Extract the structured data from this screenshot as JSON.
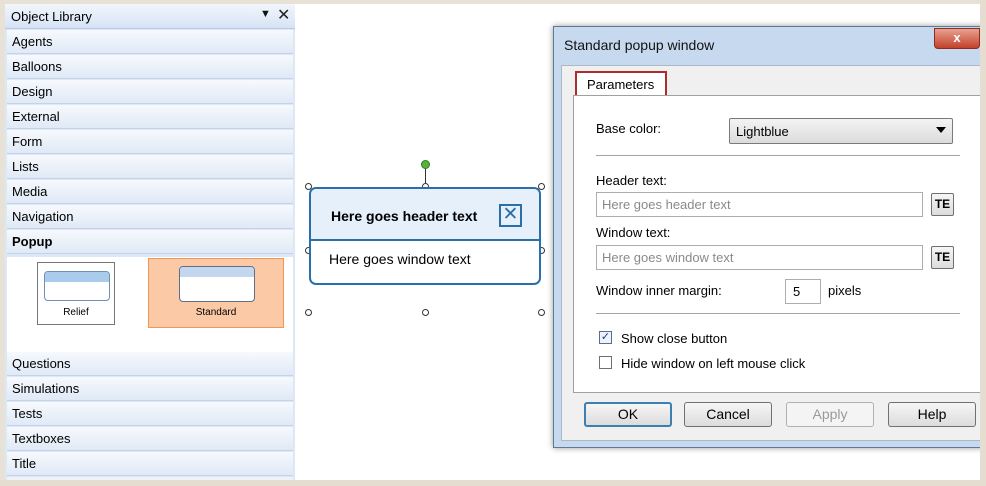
{
  "library": {
    "title": "Object Library",
    "pin_icon": "dropdown-arrow-icon",
    "close_icon": "close-icon",
    "categories_top": [
      "Agents",
      "Balloons",
      "Design",
      "External",
      "Form",
      "Lists",
      "Media",
      "Navigation",
      "Popup"
    ],
    "active_category": "Popup",
    "popup_items": [
      {
        "label": "Relief",
        "selected": false
      },
      {
        "label": "Standard",
        "selected": true
      }
    ],
    "categories_bottom": [
      "Questions",
      "Simulations",
      "Tests",
      "Textboxes",
      "Title"
    ]
  },
  "preview": {
    "header_text": "Here goes header text",
    "window_text": "Here goes window text",
    "close_glyph": "✕"
  },
  "dialog": {
    "title": "Standard popup window",
    "close_glyph": "x",
    "tab_label": "Parameters",
    "base_color_label": "Base color:",
    "base_color_value": "Lightblue",
    "header_text_label": "Header text:",
    "header_text_value": "Here goes header text",
    "window_text_label": "Window text:",
    "window_text_value": "Here goes window text",
    "te_label": "TE",
    "margin_label": "Window inner margin:",
    "margin_value": "5",
    "margin_unit": "pixels",
    "show_close_label": "Show close button",
    "show_close_checked": true,
    "hide_window_label": "Hide window on left mouse click",
    "hide_window_checked": false,
    "buttons": {
      "ok": "OK",
      "cancel": "Cancel",
      "apply": "Apply",
      "help": "Help"
    }
  },
  "colors": {
    "panel_bg": "#dde8f7",
    "selected_item": "#fbc9a6",
    "popup_border": "#2a6fa8",
    "tab_highlight": "#b22b2b"
  }
}
